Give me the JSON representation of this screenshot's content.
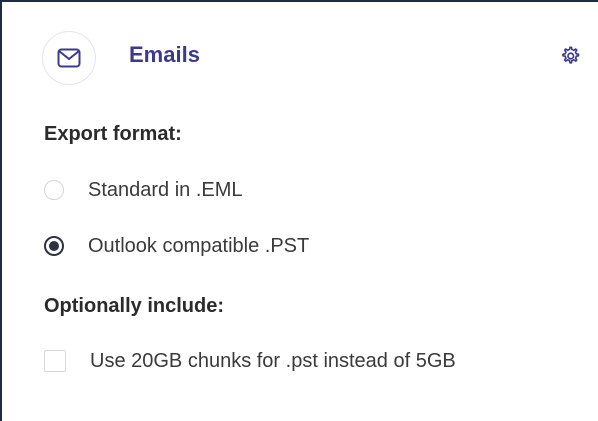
{
  "header": {
    "icon": "envelope-icon",
    "title": "Emails",
    "settings_icon": "gear-icon"
  },
  "export_format": {
    "label": "Export format:",
    "options": [
      {
        "label": "Standard in .EML",
        "selected": false
      },
      {
        "label": "Outlook compatible .PST",
        "selected": true
      }
    ]
  },
  "optional": {
    "label": "Optionally include:",
    "options": [
      {
        "label": "Use 20GB chunks for .pst instead of 5GB",
        "checked": false
      }
    ]
  },
  "colors": {
    "accent": "#3b3a8c",
    "text": "#2b2b2b",
    "radio_checked": "#2e3140",
    "border": "#1f2a44"
  }
}
